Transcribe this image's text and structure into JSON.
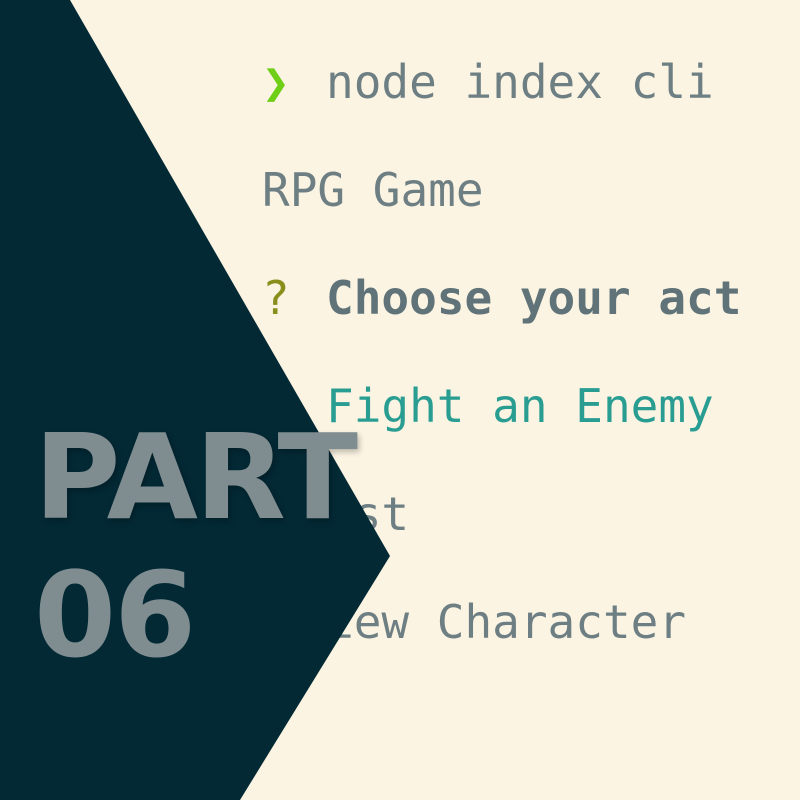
{
  "terminal": {
    "prompt_icon": "chevron-right-icon",
    "command": "node index cli",
    "title": "RPG Game",
    "question_icon": "question-mark-icon",
    "question": "Choose your act",
    "options": [
      "Fight an Enemy",
      "est",
      "iew Character"
    ]
  },
  "banner": {
    "label": "PART",
    "number": "06"
  },
  "colors": {
    "background": "#fbf4e3",
    "panel": "#032935",
    "prompt_green": "#6fcf17",
    "question_olive": "#8a8f1c",
    "active_teal": "#2a9d92",
    "text_gray": "#6e7f84",
    "banner_text": "#7f8d91"
  }
}
